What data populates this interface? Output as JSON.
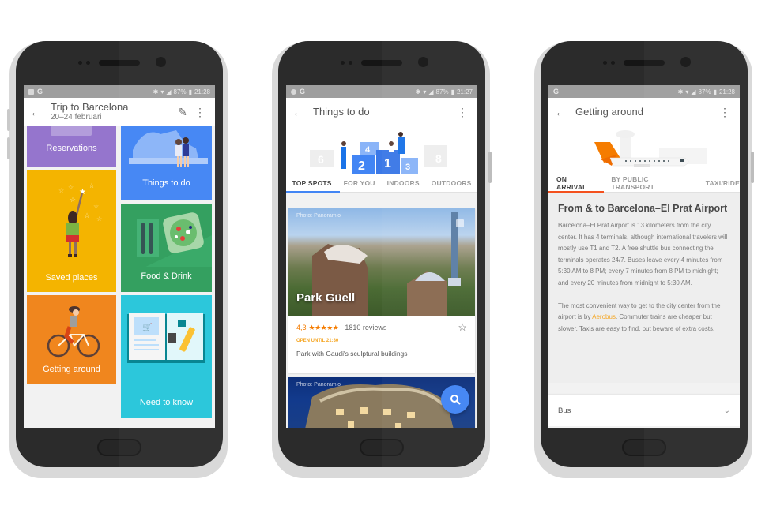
{
  "phones": [
    {
      "status": {
        "left_icons": [
          "image-icon",
          "google-icon"
        ],
        "g": "G",
        "battery": "87%",
        "time": "21:28"
      },
      "appbar": {
        "back_icon": "arrow-left-icon",
        "title": "Trip to Barcelona",
        "subtitle": "20–24 februari",
        "actions": [
          "pencil-icon",
          "more-vert-icon"
        ]
      },
      "tiles": [
        {
          "label": "Reservations",
          "color": "#9575cd",
          "icon": "ticket-illustration"
        },
        {
          "label": "Things to do",
          "color": "#4285f4",
          "icon": "couple-illustration"
        },
        {
          "label": "Saved places",
          "color": "#f4b400",
          "icon": "girl-stars-illustration"
        },
        {
          "label": "Food & Drink",
          "color": "#2e9d5b",
          "icon": "salad-plate-illustration"
        },
        {
          "label": "Getting around",
          "color": "#f0861e",
          "icon": "cyclist-illustration"
        },
        {
          "label": "Need to know",
          "color": "#26c6da",
          "icon": "guidebook-illustration"
        }
      ]
    },
    {
      "status": {
        "g": "G",
        "battery": "87%",
        "time": "21:27"
      },
      "appbar": {
        "back_icon": "arrow-left-icon",
        "title": "Things to do",
        "actions": [
          "more-vert-icon"
        ]
      },
      "hero": {
        "podium_numbers": [
          "6",
          "4",
          "2",
          "1",
          "3",
          "8"
        ]
      },
      "tabs": [
        {
          "label": "TOP SPOTS",
          "active": true
        },
        {
          "label": "FOR YOU",
          "active": false
        },
        {
          "label": "INDOORS",
          "active": false
        },
        {
          "label": "OUTDOORS",
          "active": false
        }
      ],
      "accent": "#4285f4",
      "cards": [
        {
          "credit": "Photo: Panoramio",
          "name": "Park Güell",
          "rating": "4,3",
          "stars": "★★★★★",
          "reviews": "1810 reviews",
          "hours": "OPEN UNTIL 21:30",
          "hours_color": "#f5a623",
          "description": "Park with Gaudi's sculptural buildings"
        },
        {
          "credit": "Photo: Panoramio"
        }
      ],
      "fab_icon": "search-icon"
    },
    {
      "status": {
        "g": "G",
        "battery": "87%",
        "time": "21:28"
      },
      "appbar": {
        "back_icon": "arrow-left-icon",
        "title": "Getting around",
        "actions": [
          "more-vert-icon"
        ]
      },
      "tabs": [
        {
          "label": "ON ARRIVAL",
          "active": true
        },
        {
          "label": "BY PUBLIC TRANSPORT",
          "active": false
        },
        {
          "label": "TAXI/RIDE",
          "active": false
        }
      ],
      "accent": "#f4511e",
      "section": {
        "heading": "From & to Barcelona–El Prat Airport",
        "para1": "Barcelona–El Prat Airport is 13 kilometers from the city center. It has 4 terminals, although international travelers will mostly use T1 and T2. A free shuttle bus connecting the terminals operates 24/7. Buses leave every 4 minutes from 5:30 AM to 8 PM; every 7 minutes from 8 PM to midnight; and every 20 minutes from midnight to 5:30 AM.",
        "para2_before": "The most convenient way to get to the city center from the airport is by ",
        "para2_link": "Aerobus",
        "para2_after": ". Commuter trains are cheaper but slower. Taxis are easy to find, but beware of extra costs."
      },
      "accordion": {
        "label": "Bus",
        "icon": "chevron-down-icon"
      }
    }
  ]
}
